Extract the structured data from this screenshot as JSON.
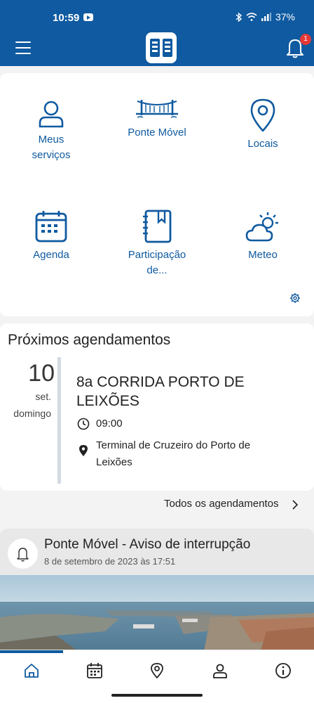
{
  "status_bar": {
    "time": "10:59",
    "battery": "37%"
  },
  "app_bar": {
    "notification_count": "1"
  },
  "shortcuts": [
    {
      "label": "Meus serviços",
      "icon": "person-icon"
    },
    {
      "label": "Ponte Móvel",
      "icon": "bridge-icon"
    },
    {
      "label": "Locais",
      "icon": "location-pin-icon"
    },
    {
      "label": "Agenda",
      "icon": "calendar-icon"
    },
    {
      "label": "Participação de...",
      "icon": "notebook-icon"
    },
    {
      "label": "Meteo",
      "icon": "weather-icon"
    }
  ],
  "schedule": {
    "title": "Próximos agendamentos",
    "day": "10",
    "month": "set.",
    "weekday": "domingo",
    "event_title": "8a CORRIDA PORTO DE LEIXÕES",
    "event_time": "09:00",
    "event_location": "Terminal de Cruzeiro do Porto de Leixões",
    "all_link": "Todos os agendamentos"
  },
  "news": {
    "title": "Ponte Móvel - Aviso de interrupção",
    "date": "8 de setembro de 2023 às 17:51"
  },
  "colors": {
    "primary": "#0f5aa0",
    "background": "#f3f3f3",
    "badge": "#e53935"
  }
}
